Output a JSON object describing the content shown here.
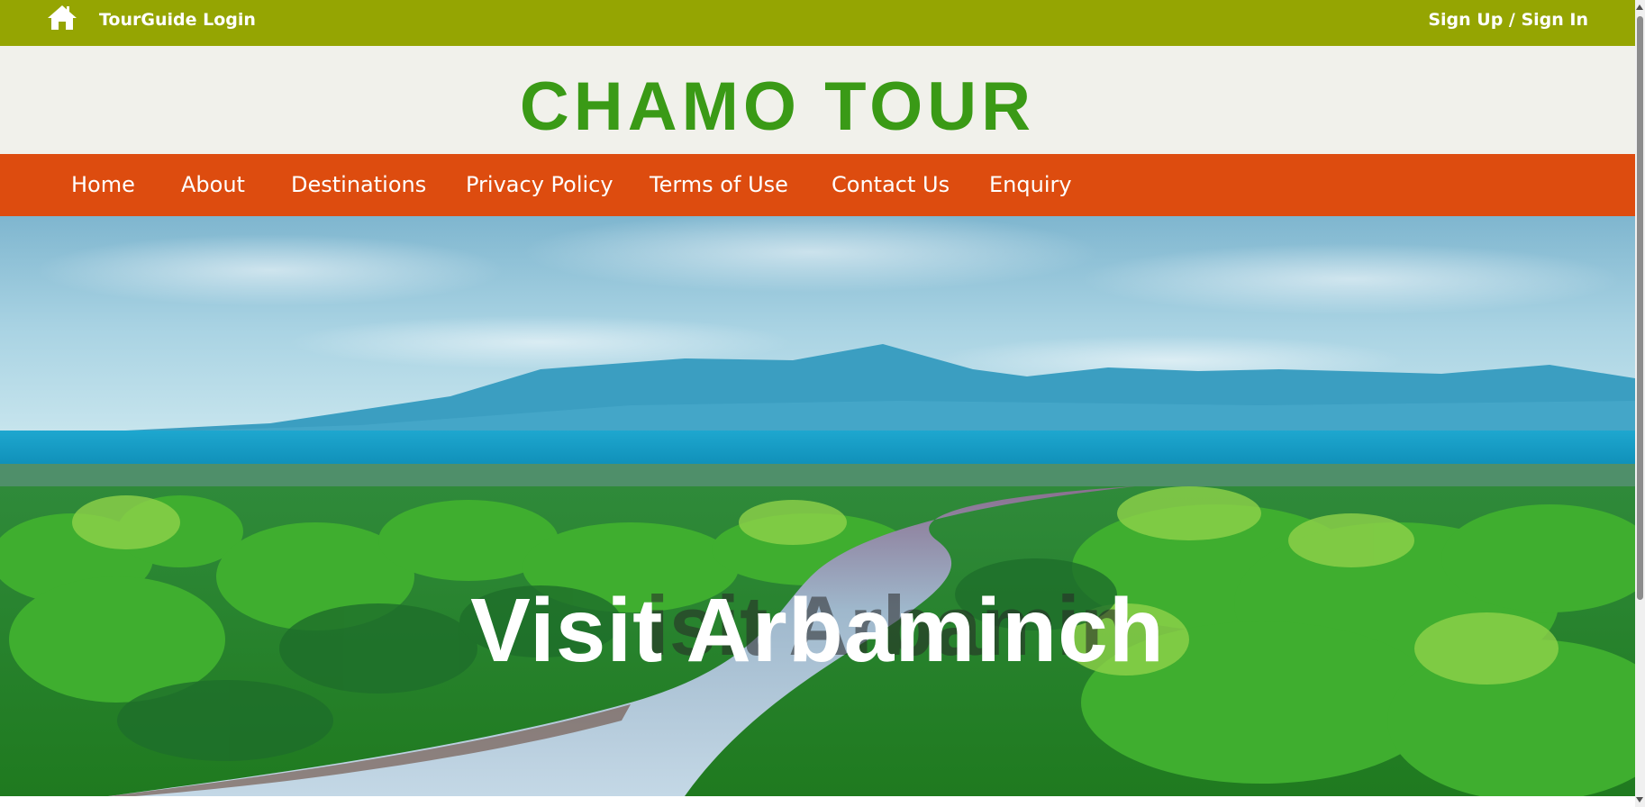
{
  "topbar": {
    "home_icon": "home-icon",
    "tourguide_login": "TourGuide Login",
    "signup_signin": "Sign Up / Sign In"
  },
  "brand": {
    "title": "CHAMO TOUR"
  },
  "nav": {
    "items": [
      {
        "label": "Home"
      },
      {
        "label": "About"
      },
      {
        "label": "Destinations"
      },
      {
        "label": "Privacy Policy"
      },
      {
        "label": "Terms of Use"
      },
      {
        "label": "Contact Us"
      },
      {
        "label": "Enquiry"
      }
    ]
  },
  "hero": {
    "title": "Visit Arbaminch",
    "shadow_text": "isit Arbamin"
  },
  "colors": {
    "topbar_bg": "#95a502",
    "brand_bg": "#f1f1eb",
    "brand_text": "#3a9a16",
    "nav_bg": "#dd4c0f"
  }
}
